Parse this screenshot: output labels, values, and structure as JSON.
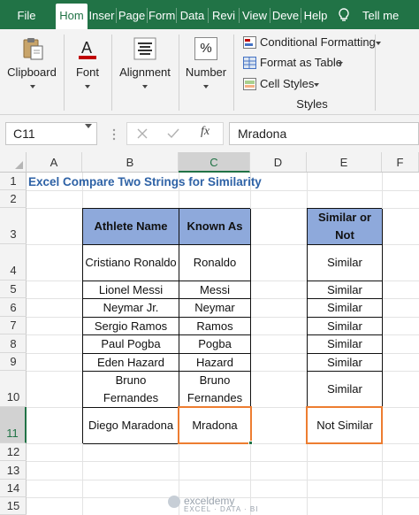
{
  "ribbon_tabs": {
    "file": "File",
    "home": "Hom",
    "insert": "Inser",
    "page_layout": "Page",
    "formulas": "Form",
    "data": "Data",
    "review": "Revi",
    "view": "View",
    "developer": "Deve",
    "help": "Help",
    "tell_me": "Tell me"
  },
  "ribbon": {
    "clipboard": "Clipboard",
    "font": "Font",
    "alignment": "Alignment",
    "number": "Number",
    "number_symbol": "%",
    "conditional_formatting": "Conditional Formatting",
    "format_as_table": "Format as Table",
    "cell_styles": "Cell Styles",
    "styles_group": "Styles"
  },
  "formula_bar": {
    "name_box": "C11",
    "fx_label": "fx",
    "content": "Mradona"
  },
  "columns": [
    "A",
    "B",
    "C",
    "D",
    "E",
    "F"
  ],
  "rows": [
    "1",
    "2",
    "3",
    "4",
    "5",
    "6",
    "7",
    "8",
    "9",
    "10",
    "11",
    "12",
    "13",
    "14",
    "15"
  ],
  "sheet_title": "Excel Compare Two Strings for Similarity",
  "table": {
    "headers": {
      "athlete": "Athlete Name",
      "known_as": "Known As",
      "similar": "Similar or Not"
    },
    "rows": [
      {
        "athlete": "Cristiano Ronaldo",
        "known_as": "Ronaldo",
        "result": "Similar"
      },
      {
        "athlete": "Lionel Messi",
        "known_as": "Messi",
        "result": "Similar"
      },
      {
        "athlete": "Neymar Jr.",
        "known_as": "Neymar",
        "result": "Similar"
      },
      {
        "athlete": "Sergio Ramos",
        "known_as": "Ramos",
        "result": "Similar"
      },
      {
        "athlete": "Paul Pogba",
        "known_as": "Pogba",
        "result": "Similar"
      },
      {
        "athlete": "Eden Hazard",
        "known_as": "Hazard",
        "result": "Similar"
      },
      {
        "athlete": "Bruno Fernandes",
        "known_as": "Bruno Fernandes",
        "result": "Similar"
      },
      {
        "athlete": "Diego Maradona",
        "known_as": "Mradona",
        "result": "Not Similar"
      }
    ]
  },
  "watermark": {
    "name": "exceldemy",
    "tagline": "EXCEL · DATA · BI"
  },
  "colors": {
    "excel_green": "#217346",
    "header_fill": "#8ea9db",
    "highlight": "#ed7d31",
    "title_text": "#2e62a6"
  }
}
